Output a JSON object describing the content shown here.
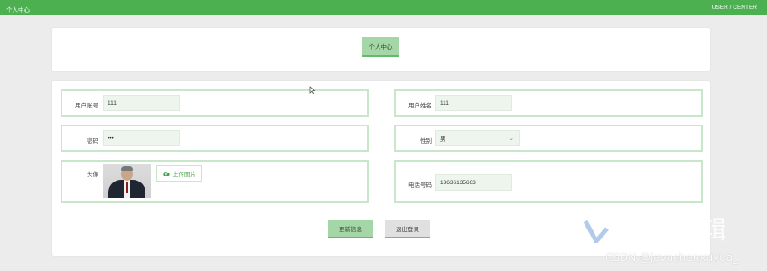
{
  "header": {
    "title": "个人中心",
    "breadcrumb": "USER / CENTER"
  },
  "head_panel": {
    "center_button": "个人中心"
  },
  "form": {
    "username": {
      "label": "用户账号",
      "value": "111"
    },
    "realname": {
      "label": "用户姓名",
      "value": "111"
    },
    "password": {
      "label": "密码",
      "value": "•••"
    },
    "gender": {
      "label": "性别",
      "value": "男"
    },
    "avatar": {
      "label": "头像",
      "upload_label": "上传图片"
    },
    "phone": {
      "label": "电话号码",
      "value": "13636135663"
    }
  },
  "actions": {
    "update_label": "更新信息",
    "logout_label": "退出登录"
  },
  "watermark": {
    "char": "辑",
    "text": "CSDN @javachenxuyua_"
  },
  "colors": {
    "accent": "#4caf50",
    "button_green": "#a5d6a7",
    "field_border": "#c8e6c9"
  },
  "icons": {
    "upload": "cloud-upload-icon",
    "select": "chevron-down-icon",
    "cursor": "mouse-cursor-icon"
  }
}
